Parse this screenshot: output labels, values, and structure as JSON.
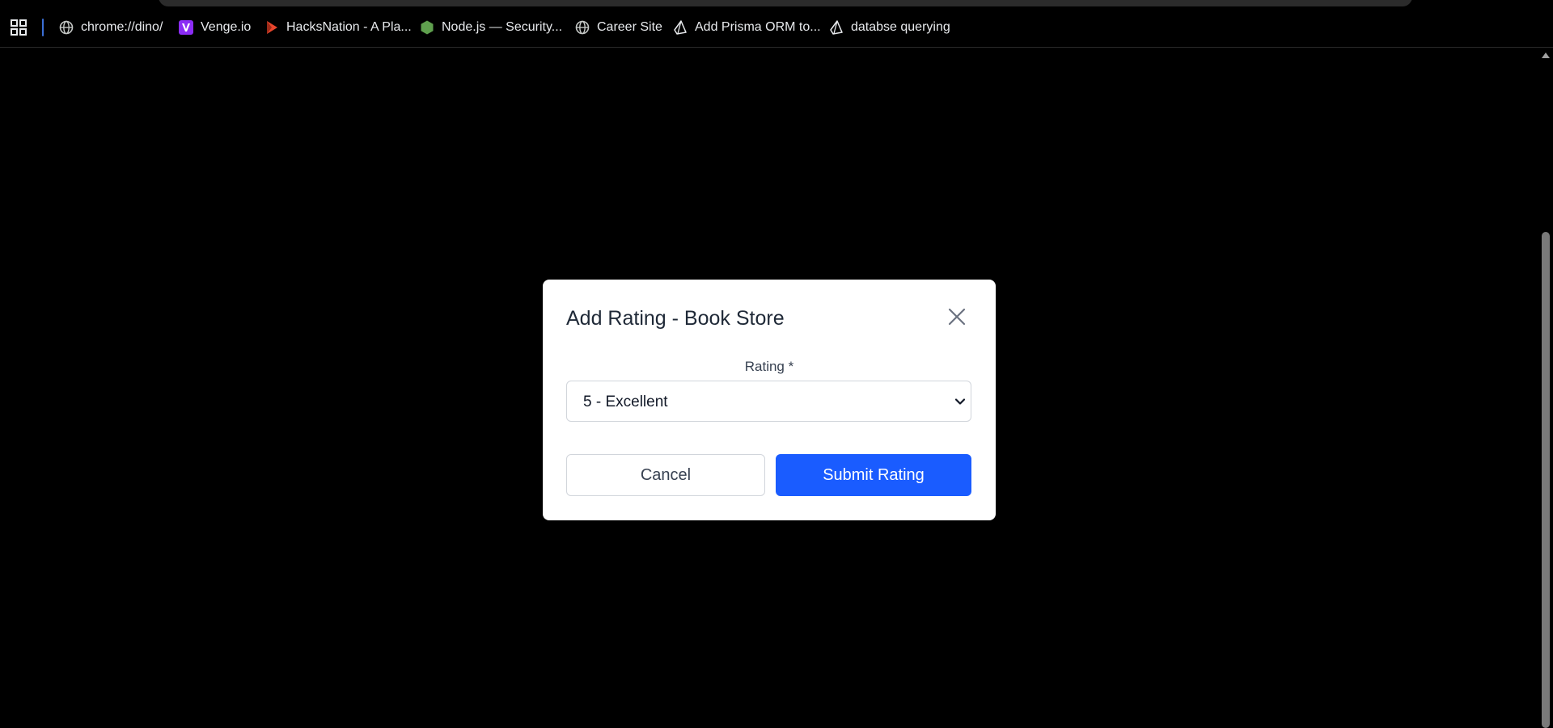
{
  "bookmarks": {
    "items": [
      {
        "label": "chrome://dino/",
        "icon": "globe-icon"
      },
      {
        "label": "Venge.io",
        "icon": "venge-icon"
      },
      {
        "label": "HacksNation - A Pla...",
        "icon": "hacksnation-icon"
      },
      {
        "label": "Node.js — Security...",
        "icon": "nodejs-icon"
      },
      {
        "label": "Career Site",
        "icon": "globe-icon"
      },
      {
        "label": "Add Prisma ORM to...",
        "icon": "prisma-icon"
      },
      {
        "label": "databse querying",
        "icon": "prisma-icon"
      }
    ]
  },
  "modal": {
    "title": "Add Rating - Book Store",
    "rating_label": "Rating *",
    "rating_value": "5 - Excellent",
    "cancel_label": "Cancel",
    "submit_label": "Submit Rating"
  },
  "colors": {
    "background": "#000000",
    "primary": "#1a5cff",
    "modal_bg": "#ffffff"
  }
}
